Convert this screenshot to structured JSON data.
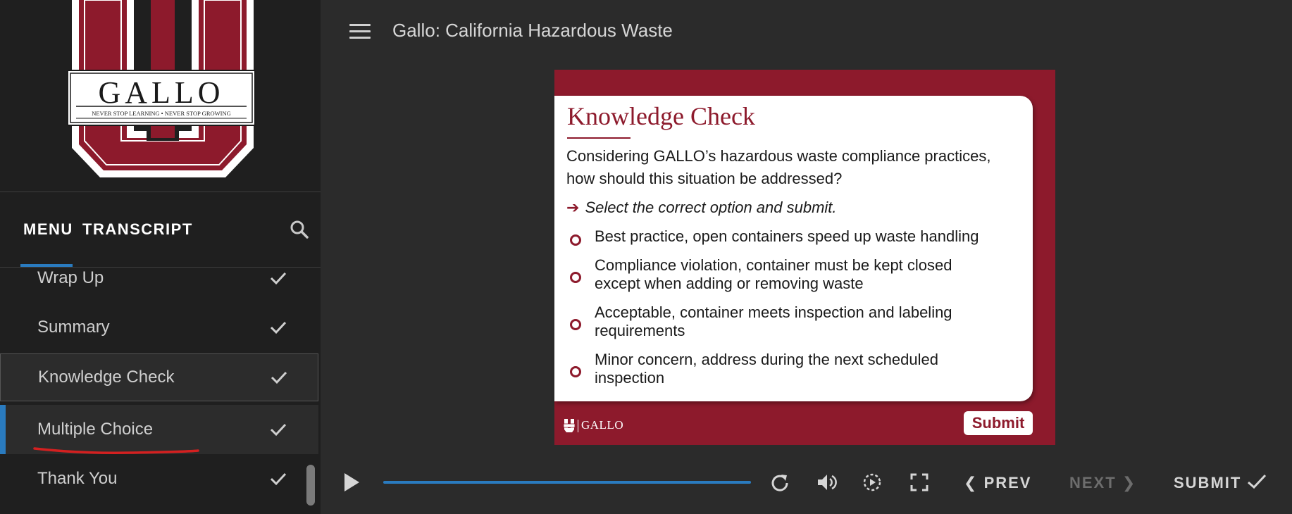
{
  "sidebar": {
    "logo": {
      "text": "GALLO",
      "tagline": "NEVER STOP LEARNING • NEVER STOP GROWING"
    },
    "tabs": {
      "menu": "MENU",
      "transcript": "TRANSCRIPT"
    },
    "items": [
      {
        "label": "Wrap Up",
        "completed": true
      },
      {
        "label": "Summary",
        "completed": true
      },
      {
        "label": "Knowledge Check",
        "completed": true
      },
      {
        "label": "Multiple Choice",
        "completed": true,
        "active": true
      },
      {
        "label": "Thank You",
        "completed": true
      }
    ]
  },
  "header": {
    "title": "Gallo: California Hazardous Waste"
  },
  "slide": {
    "title": "Knowledge Check",
    "question": "Considering GALLO’s hazardous waste compliance practices, how should this situation be addressed?",
    "instruction": "Select the correct option and submit.",
    "options": [
      "Best practice, open containers speed up waste handling",
      "Compliance violation, container must be kept closed except when adding or removing waste",
      "Acceptable, container meets inspection and labeling requirements",
      "Minor concern, address during the next scheduled inspection"
    ],
    "footer_logo": "GALLO",
    "submit_label": "Submit"
  },
  "player": {
    "prev_label": "PREV",
    "next_label": "NEXT",
    "submit_label": "SUBMIT",
    "progress": 1.0
  },
  "colors": {
    "brand": "#8d1a2c",
    "accent": "#2a7bbf",
    "annotation": "#d42020"
  }
}
